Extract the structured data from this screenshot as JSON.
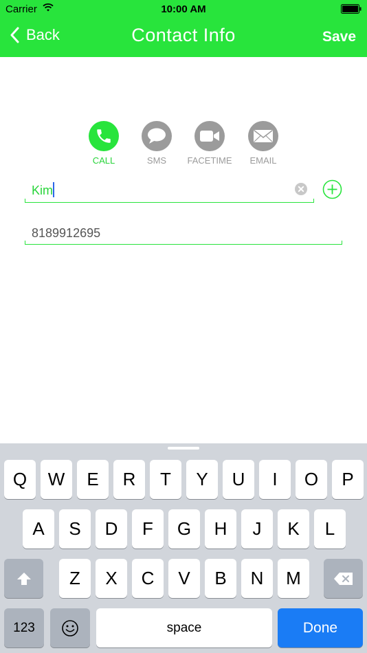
{
  "status_bar": {
    "carrier": "Carrier",
    "time": "10:00 AM"
  },
  "nav": {
    "back_label": "Back",
    "title": "Contact Info",
    "save_label": "Save"
  },
  "colors": {
    "accent": "#28e43c",
    "inactive": "#9b9b9b",
    "done_key": "#1a7cf5"
  },
  "actions": [
    {
      "label": "CALL",
      "icon": "phone-icon",
      "selected": true
    },
    {
      "label": "SMS",
      "icon": "chat-bubble-icon",
      "selected": false
    },
    {
      "label": "FACETIME",
      "icon": "video-camera-icon",
      "selected": false
    },
    {
      "label": "EMAIL",
      "icon": "envelope-icon",
      "selected": false
    }
  ],
  "form": {
    "name_value": "Kim",
    "phone_value": "8189912695"
  },
  "keyboard": {
    "row1": [
      "Q",
      "W",
      "E",
      "R",
      "T",
      "Y",
      "U",
      "I",
      "O",
      "P"
    ],
    "row2": [
      "A",
      "S",
      "D",
      "F",
      "G",
      "H",
      "J",
      "K",
      "L"
    ],
    "row3": [
      "Z",
      "X",
      "C",
      "V",
      "B",
      "N",
      "M"
    ],
    "numbers_label": "123",
    "space_label": "space",
    "done_label": "Done"
  }
}
